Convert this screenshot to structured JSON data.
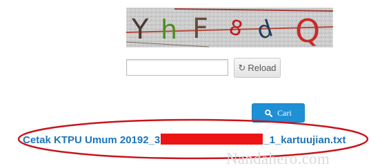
{
  "captcha": {
    "characters": [
      "Y",
      "h",
      "F",
      "8",
      "d",
      "Q"
    ],
    "character_colors": [
      "#4a3b34",
      "#4a8f1d",
      "#6b4a3a",
      "#c0181f",
      "#203f5b",
      "#c72a2a"
    ],
    "background_color": "#c9c9c9"
  },
  "form": {
    "captcha_input_value": "",
    "reload_label": "Reload",
    "reload_icon": "refresh-icon",
    "search_label": "Cari",
    "search_icon": "search-icon"
  },
  "result": {
    "link_prefix": "Cetak KTPU Umum 20192_3",
    "link_suffix": "_1_kartuujian.txt",
    "redaction_color": "#ec1414",
    "highlight_color": "#c8141c"
  },
  "watermark": "Nandahero.com",
  "colors": {
    "link": "#1f74b8",
    "primary_button": "#1f8fd6"
  }
}
